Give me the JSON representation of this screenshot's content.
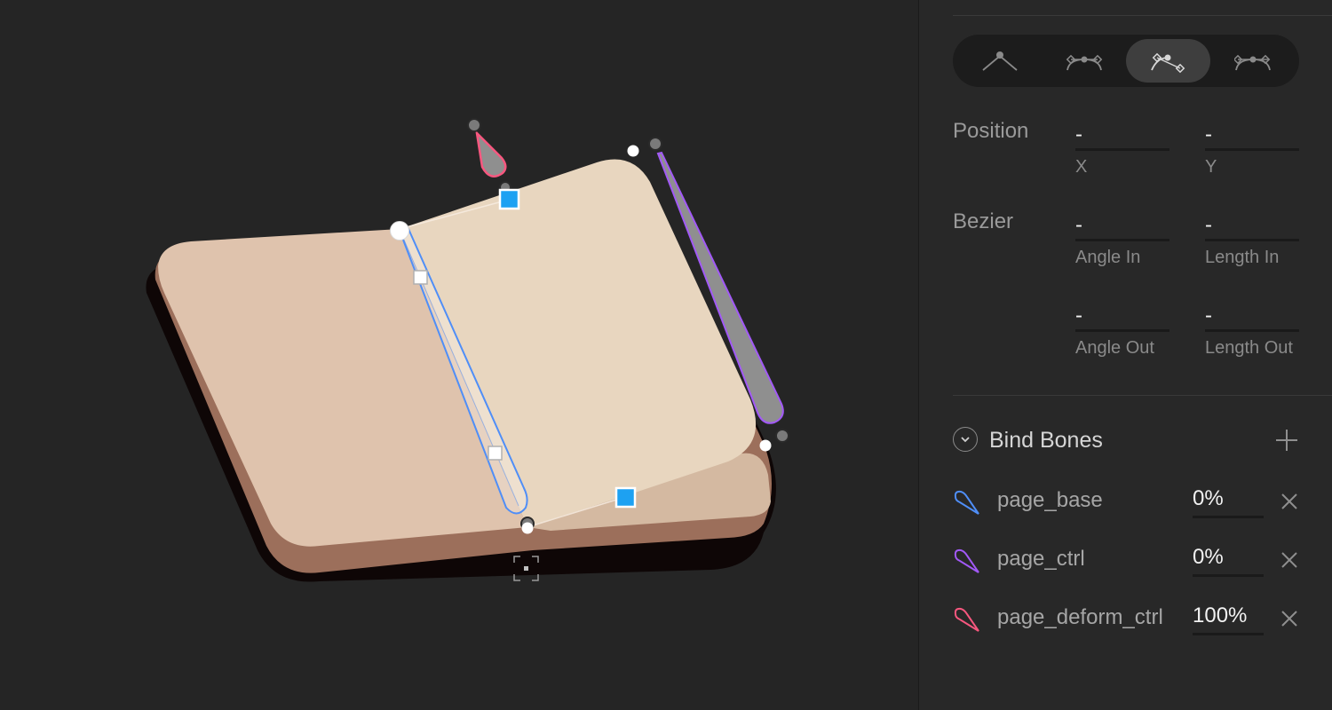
{
  "toolbar": {
    "vertex_modes": [
      {
        "icon": "straight-vertex-icon",
        "active": false
      },
      {
        "icon": "mirrored-vertex-icon",
        "active": false
      },
      {
        "icon": "detached-vertex-icon",
        "active": true
      },
      {
        "icon": "asymmetric-vertex-icon",
        "active": false
      }
    ]
  },
  "properties": {
    "position": {
      "label": "Position",
      "x": {
        "value": "-",
        "sublabel": "X"
      },
      "y": {
        "value": "-",
        "sublabel": "Y"
      }
    },
    "bezier": {
      "label": "Bezier",
      "angle_in": {
        "value": "-",
        "sublabel": "Angle In"
      },
      "length_in": {
        "value": "-",
        "sublabel": "Length In"
      },
      "angle_out": {
        "value": "-",
        "sublabel": "Angle Out"
      },
      "length_out": {
        "value": "-",
        "sublabel": "Length Out"
      }
    }
  },
  "bind_bones": {
    "title": "Bind Bones",
    "items": [
      {
        "name": "page_base",
        "weight": "0%",
        "color": "#4f8ef7"
      },
      {
        "name": "page_ctrl",
        "weight": "0%",
        "color": "#a259f7"
      },
      {
        "name": "page_deform_ctrl",
        "weight": "100%",
        "color": "#f7577f"
      }
    ]
  },
  "colors": {
    "canvas_bg": "#252525",
    "panel_bg": "#282828",
    "selection_accent": "#1da1f2",
    "book_cover": "#9c6f5b",
    "page_left": "#dfc3ad",
    "page_right": "#e8d6bf"
  }
}
